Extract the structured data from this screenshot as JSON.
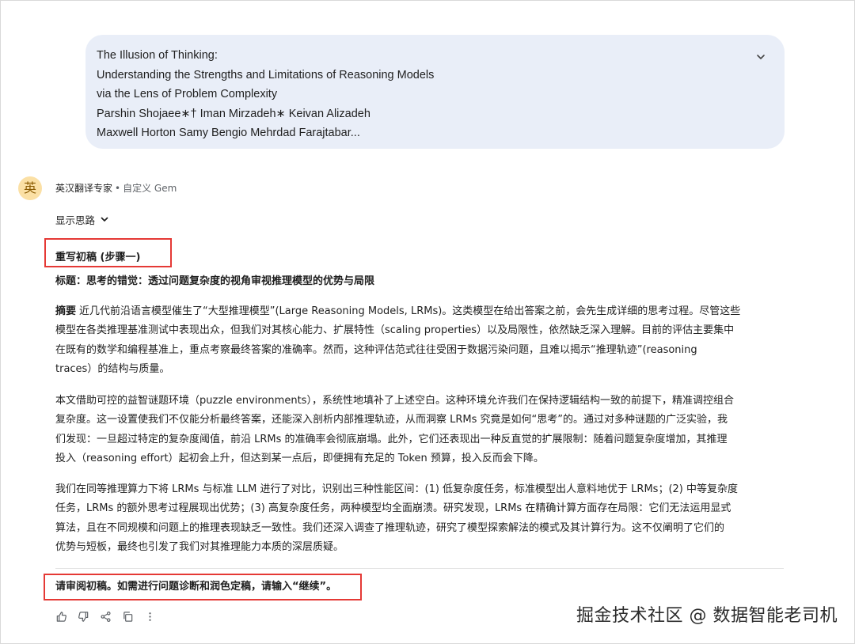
{
  "prompt": {
    "lines": [
      "The Illusion of Thinking:",
      "Understanding the Strengths and Limitations of Reasoning Models",
      "via the Lens of Problem Complexity",
      "Parshin Shojaee∗† Iman Mirzadeh∗ Keivan Alizadeh",
      "Maxwell Horton Samy Bengio Mehrdad Farajtabar..."
    ],
    "expand_icon": "chevron-down-icon"
  },
  "response": {
    "avatar_char": "英",
    "gem_name": "英汉翻译专家",
    "separator": "•",
    "gem_type": "自定义 Gem",
    "show_thinking_label": "显示思路",
    "step_heading": "重写初稿 (步骤一)",
    "title": "标题：思考的错觉：透过问题复杂度的视角审视推理模型的优势与局限",
    "abstract": {
      "lead": "摘要",
      "lines": [
        "近几代前沿语言模型催生了“大型推理模型”(Large Reasoning Models, LRMs)。这类模型在给出答案之前，会先生成详细的思考过程。尽管这些",
        "模型在各类推理基准测试中表现出众，但我们对其核心能力、扩展特性（scaling properties）以及局限性，依然缺乏深入理解。目前的评估主要集中",
        "在既有的数学和编程基准上，重点考察最终答案的准确率。然而，这种评估范式往往受困于数据污染问题，且难以揭示“推理轨迹”(reasoning",
        "traces）的结构与质量。"
      ]
    },
    "paragraph2": [
      "本文借助可控的益智谜题环境（puzzle environments），系统性地填补了上述空白。这种环境允许我们在保持逻辑结构一致的前提下，精准调控组合",
      "复杂度。这一设置使我们不仅能分析最终答案，还能深入剖析内部推理轨迹，从而洞察 LRMs 究竟是如何“思考”的。通过对多种谜题的广泛实验，我",
      "们发现：一旦超过特定的复杂度阈值，前沿 LRMs 的准确率会彻底崩塌。此外，它们还表现出一种反直觉的扩展限制：随着问题复杂度增加，其推理",
      "投入（reasoning effort）起初会上升，但达到某一点后，即便拥有充足的 Token 预算，投入反而会下降。"
    ],
    "paragraph3": [
      "我们在同等推理算力下将 LRMs 与标准 LLM 进行了对比，识别出三种性能区间：(1) 低复杂度任务，标准模型出人意料地优于 LRMs；(2) 中等复杂度",
      "任务，LRMs 的额外思考过程展现出优势；(3) 高复杂度任务，两种模型均全面崩溃。研究发现，LRMs 在精确计算方面存在局限：它们无法运用显式",
      "算法，且在不同规模和问题上的推理表现缺乏一致性。我们还深入调查了推理轨迹，研究了模型探索解法的模式及其计算行为。这不仅阐明了它们的",
      "优势与短板，最终也引发了我们对其推理能力本质的深层质疑。"
    ],
    "final_prompt": "请审阅初稿。如需进行问题诊断和润色定稿，请输入“继续”。"
  },
  "action_icons": [
    "thumbs-up-icon",
    "thumbs-down-icon",
    "share-icon",
    "copy-icon",
    "more-vert-icon"
  ],
  "watermark": "掘金技术社区 @ 数据智能老司机",
  "colors": {
    "prompt_bg": "#e9eef8",
    "highlight_box": "#e53935",
    "avatar_bg": "#fbe0a5"
  }
}
